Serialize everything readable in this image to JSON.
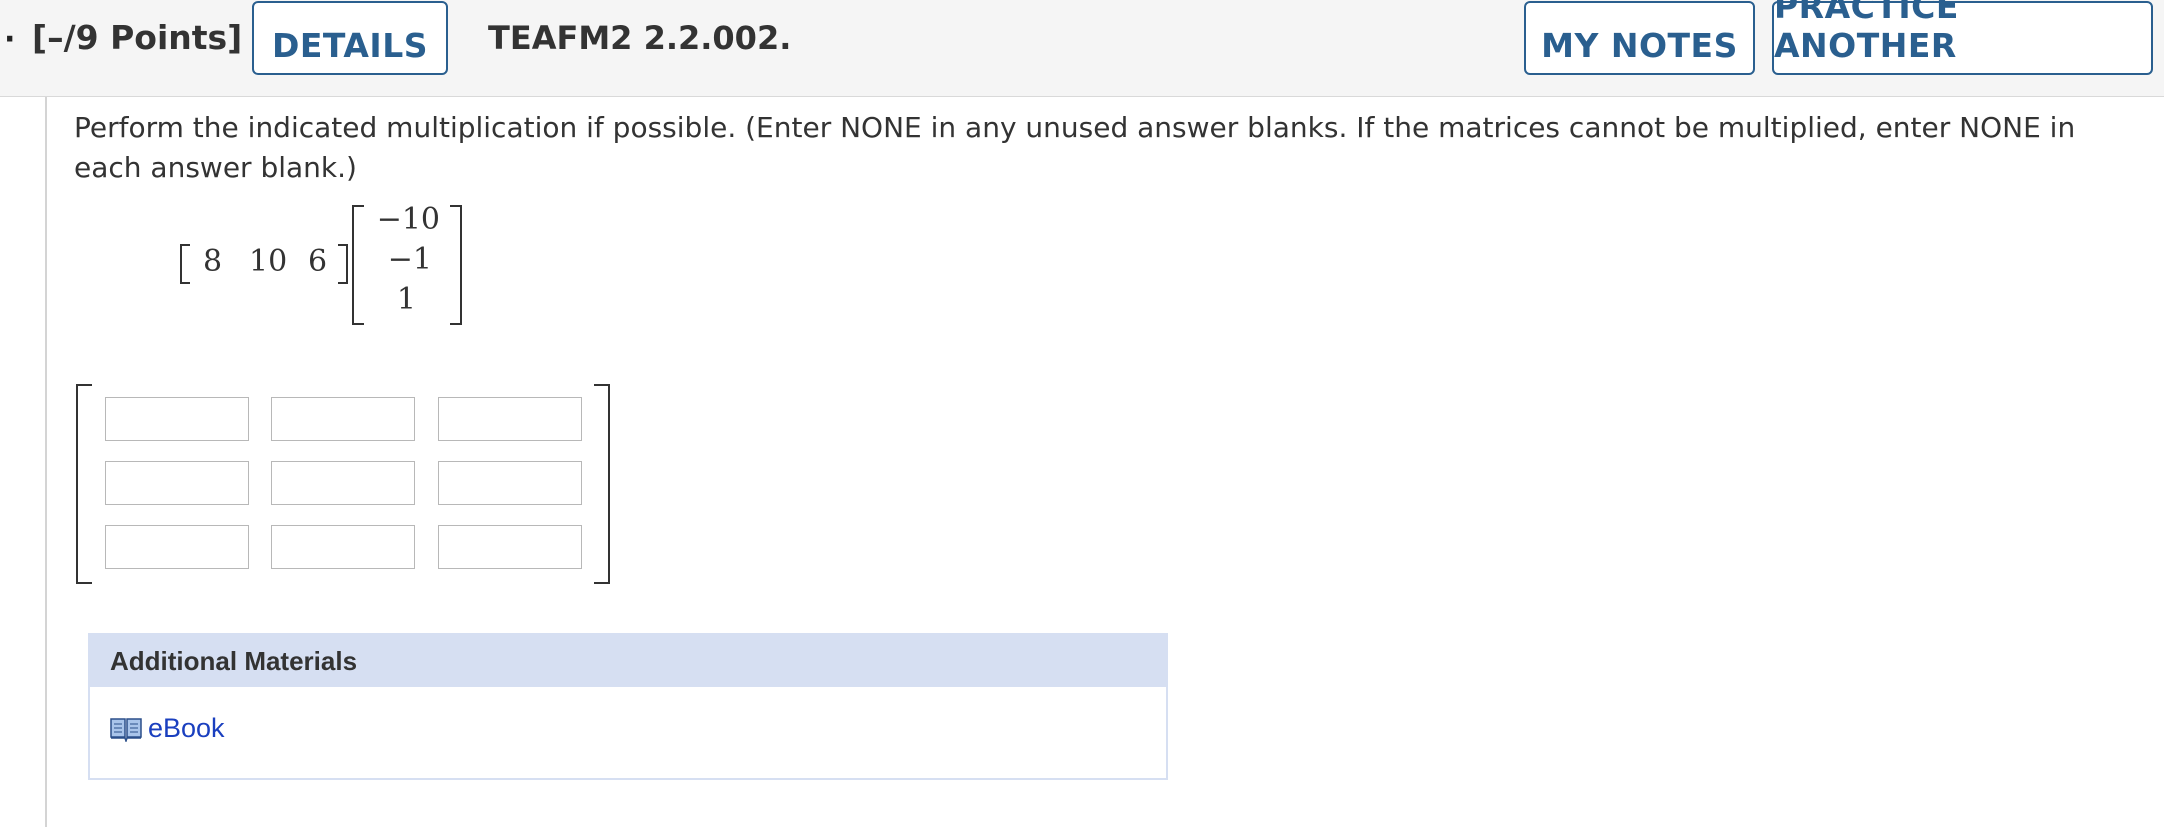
{
  "header": {
    "dot": "·",
    "points": "[–/9 Points]",
    "details_label": "DETAILS",
    "question_id": "TEAFM2 2.2.002.",
    "my_notes_label": "MY NOTES",
    "practice_label": "PRACTICE ANOTHER"
  },
  "question": {
    "prompt": "Perform the indicated multiplication if possible. (Enter NONE in any unused answer blanks. If the matrices cannot be multiplied, enter NONE in each answer blank.)",
    "row_vector": [
      "8",
      "10",
      "6"
    ],
    "column_vector": [
      "−10",
      "−1",
      "1"
    ]
  },
  "answer_grid": {
    "cells": [
      [
        "",
        "",
        ""
      ],
      [
        "",
        "",
        ""
      ],
      [
        "",
        "",
        ""
      ]
    ]
  },
  "additional_materials": {
    "title": "Additional Materials",
    "ebook_label": "eBook",
    "ebook_icon": "book-icon"
  },
  "colors": {
    "accent": "#2a5f8f",
    "panel_header": "#d6dff2",
    "link": "#1a3fbf"
  }
}
